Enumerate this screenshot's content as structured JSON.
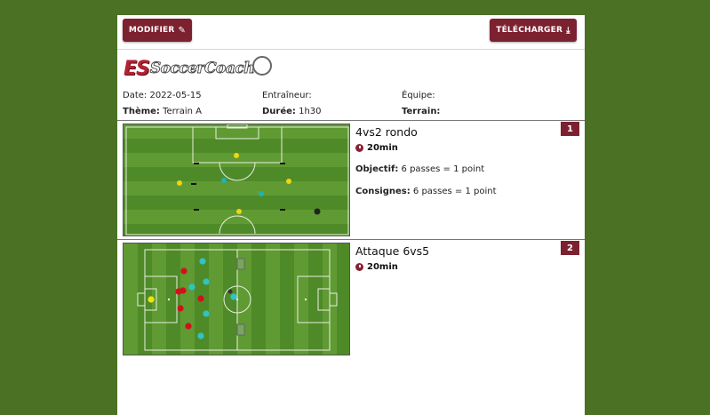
{
  "toolbar": {
    "modifier_label": "MODIFIER",
    "modifier_icon": "pencil-icon",
    "telecharger_label": "TÉLÉCHARGER",
    "telecharger_icon": "download-icon"
  },
  "logo": {
    "prefix": "ES",
    "name": "SoccerCoach"
  },
  "session": {
    "date_label": "Date:",
    "date_value": "2022-05-15",
    "trainer_label": "Entraîneur:",
    "trainer_value": "",
    "team_label": "Équipe:",
    "team_value": "",
    "theme_label": "Thème:",
    "theme_value": "Terrain A",
    "duration_label": "Durée:",
    "duration_value": "1h30",
    "field_label": "Terrain:",
    "field_value": ""
  },
  "exercises": [
    {
      "number": "1",
      "title": "4vs2 rondo",
      "duration": "20min",
      "objective_label": "Objectif:",
      "objective_value": "6 passes = 1 point",
      "instructions_label": "Consignes:",
      "instructions_value": "6 passes = 1 point"
    },
    {
      "number": "2",
      "title": "Attaque 6vs5",
      "duration": "20min"
    }
  ],
  "colors": {
    "accent": "#7c2130",
    "background": "#4b7124",
    "pitch_light": "#5f9a33",
    "pitch_dark": "#4f8a28"
  }
}
